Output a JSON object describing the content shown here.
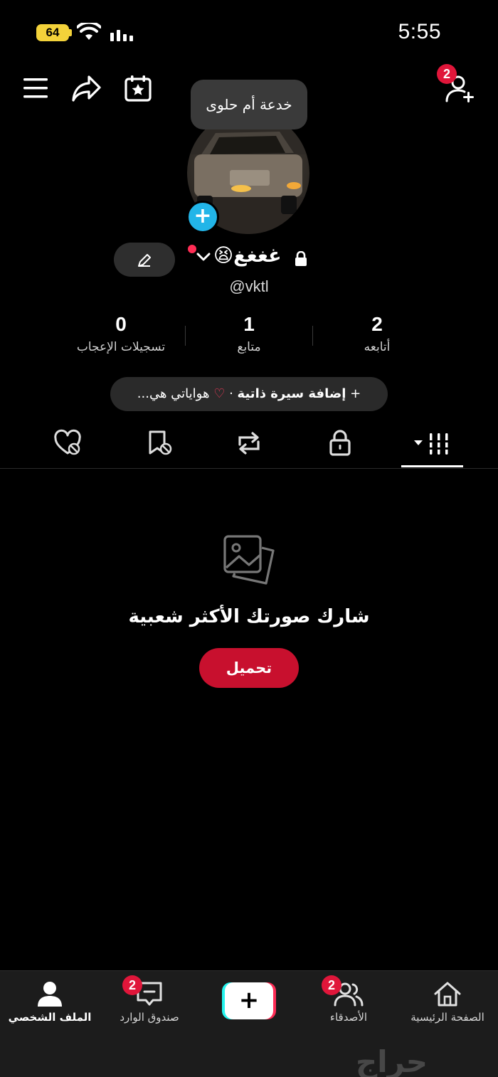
{
  "status_bar": {
    "battery": "64",
    "time": "5:55"
  },
  "header": {
    "friend_requests_badge": "2",
    "tooltip": "خدعة أم حلوى"
  },
  "profile": {
    "name": "غغغغ😫",
    "handle": "@vktl",
    "stats": {
      "following": {
        "value": "2",
        "label": "أتابعه"
      },
      "followers": {
        "value": "1",
        "label": "متابع"
      },
      "likes": {
        "value": "0",
        "label": "تسجيلات الإعجاب"
      }
    },
    "bio": {
      "add_label": "إضافة سيرة ذاتية",
      "separator": "·",
      "hobbies": "هواياتي هي..."
    }
  },
  "tabs": [
    "videos-grid",
    "private",
    "reposts",
    "favorites",
    "liked"
  ],
  "empty_state": {
    "title": "شارك صورتك الأكثر شعبية",
    "button": "تحميل"
  },
  "bottom_nav": {
    "home": "الصفحة الرئيسية",
    "friends": "الأصدقاء",
    "friends_badge": "2",
    "inbox": "صندوق الوارد",
    "inbox_badge": "2",
    "profile": "الملف الشخصي",
    "create": "+"
  },
  "watermark": "حراج",
  "colors": {
    "accent": "#c8102e",
    "badge": "#e0163a",
    "plus_blue": "#22b5e8"
  }
}
